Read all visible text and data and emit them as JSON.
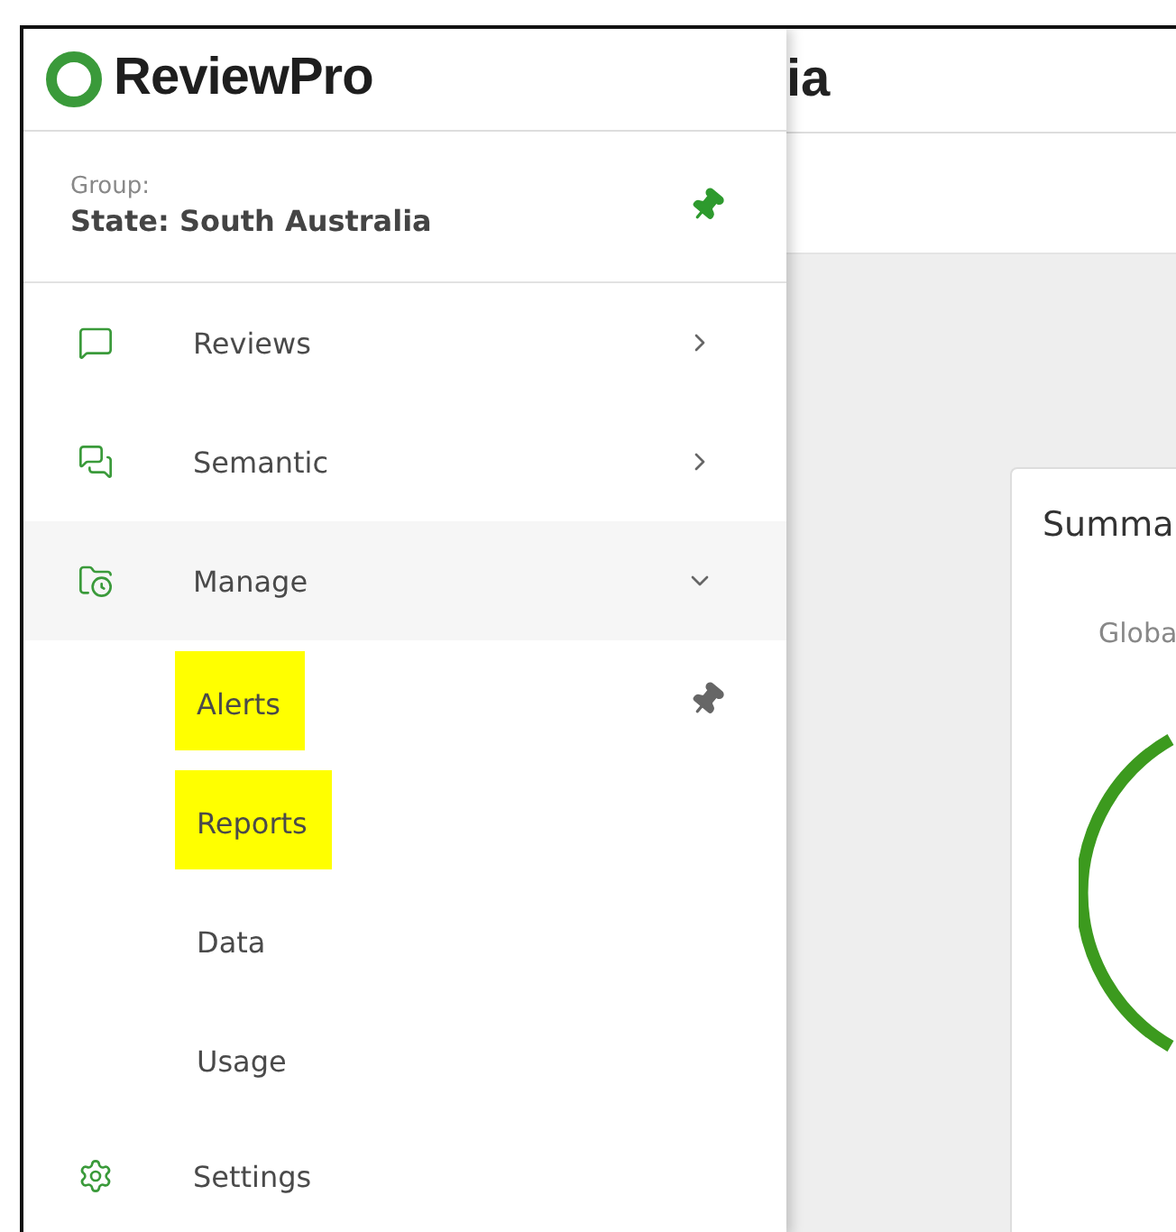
{
  "header": {
    "title": "ia"
  },
  "sidebar": {
    "logo": "ReviewPro",
    "group": {
      "label": "Group:",
      "value": "State: South Australia",
      "pinned": true
    },
    "items": [
      {
        "label": "Reviews",
        "expanded": false
      },
      {
        "label": "Semantic",
        "expanded": false
      },
      {
        "label": "Manage",
        "expanded": true,
        "children": [
          {
            "label": "Alerts",
            "highlighted": true,
            "pinned": true
          },
          {
            "label": "Reports",
            "highlighted": true,
            "pinned": false
          },
          {
            "label": "Data",
            "highlighted": false,
            "pinned": false
          },
          {
            "label": "Usage",
            "highlighted": false,
            "pinned": false
          }
        ]
      },
      {
        "label": "Settings"
      }
    ]
  },
  "card": {
    "title": "Summa",
    "subtitle": "Globa"
  }
}
